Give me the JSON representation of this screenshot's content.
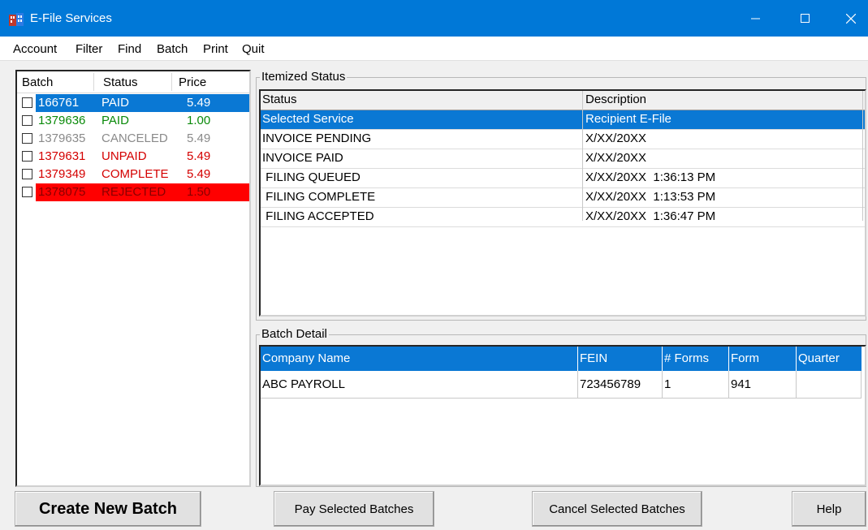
{
  "window": {
    "title": "E-File Services",
    "controls": {
      "minimize": "–",
      "maximize": "☐",
      "close": "✕"
    },
    "accent_color": "#0078d7"
  },
  "menu": [
    "Account",
    "Filter",
    "Find",
    "Batch",
    "Print",
    "Quit"
  ],
  "batch_list": {
    "columns": [
      "Batch",
      "Status",
      "Price"
    ],
    "rows": [
      {
        "batch": "166761",
        "status": "PAID",
        "price": "5.49",
        "color": "#ffffff",
        "selected": "blue"
      },
      {
        "batch": "1379636",
        "status": "PAID",
        "price": "1.00",
        "color": "#0a8a0a",
        "selected": ""
      },
      {
        "batch": "1379635",
        "status": "CANCELED",
        "price": "5.49",
        "color": "#8a8a8a",
        "selected": ""
      },
      {
        "batch": "1379631",
        "status": "UNPAID",
        "price": "5.49",
        "color": "#d40000",
        "selected": ""
      },
      {
        "batch": "1379349",
        "status": "COMPLETE",
        "price": "5.49",
        "color": "#d40000",
        "selected": ""
      },
      {
        "batch": "1378075",
        "status": "REJECTED",
        "price": "1.50",
        "color": "#8a0000",
        "selected": "red"
      }
    ]
  },
  "itemized_status": {
    "legend": "Itemized Status",
    "columns": [
      "Status",
      "Description"
    ],
    "rows": [
      {
        "status": "Selected Service",
        "description": "Recipient E-File",
        "selected": true
      },
      {
        "status": "INVOICE PENDING",
        "description": "X/XX/20XX",
        "selected": false
      },
      {
        "status": "INVOICE PAID",
        "description": "X/XX/20XX",
        "selected": false
      },
      {
        "status": " FILING QUEUED",
        "description": "X/XX/20XX  1:36:13 PM",
        "selected": false
      },
      {
        "status": " FILING COMPLETE",
        "description": "X/XX/20XX  1:13:53 PM",
        "selected": false
      },
      {
        "status": " FILING ACCEPTED",
        "description": "X/XX/20XX  1:36:47 PM",
        "selected": false
      }
    ]
  },
  "batch_detail": {
    "legend": "Batch Detail",
    "columns": [
      "Company Name",
      "FEIN",
      "# Forms",
      "Form",
      "Quarter"
    ],
    "rows": [
      {
        "company": "ABC PAYROLL",
        "fein": "723456789",
        "forms": "1",
        "form": "941",
        "quarter": ""
      }
    ]
  },
  "buttons": {
    "create": "Create New Batch",
    "pay": "Pay Selected Batches",
    "cancel": "Cancel Selected Batches",
    "help": "Help"
  },
  "colors": {
    "selection_blue": "#0a78d4",
    "rejected_red": "#ff0000"
  }
}
